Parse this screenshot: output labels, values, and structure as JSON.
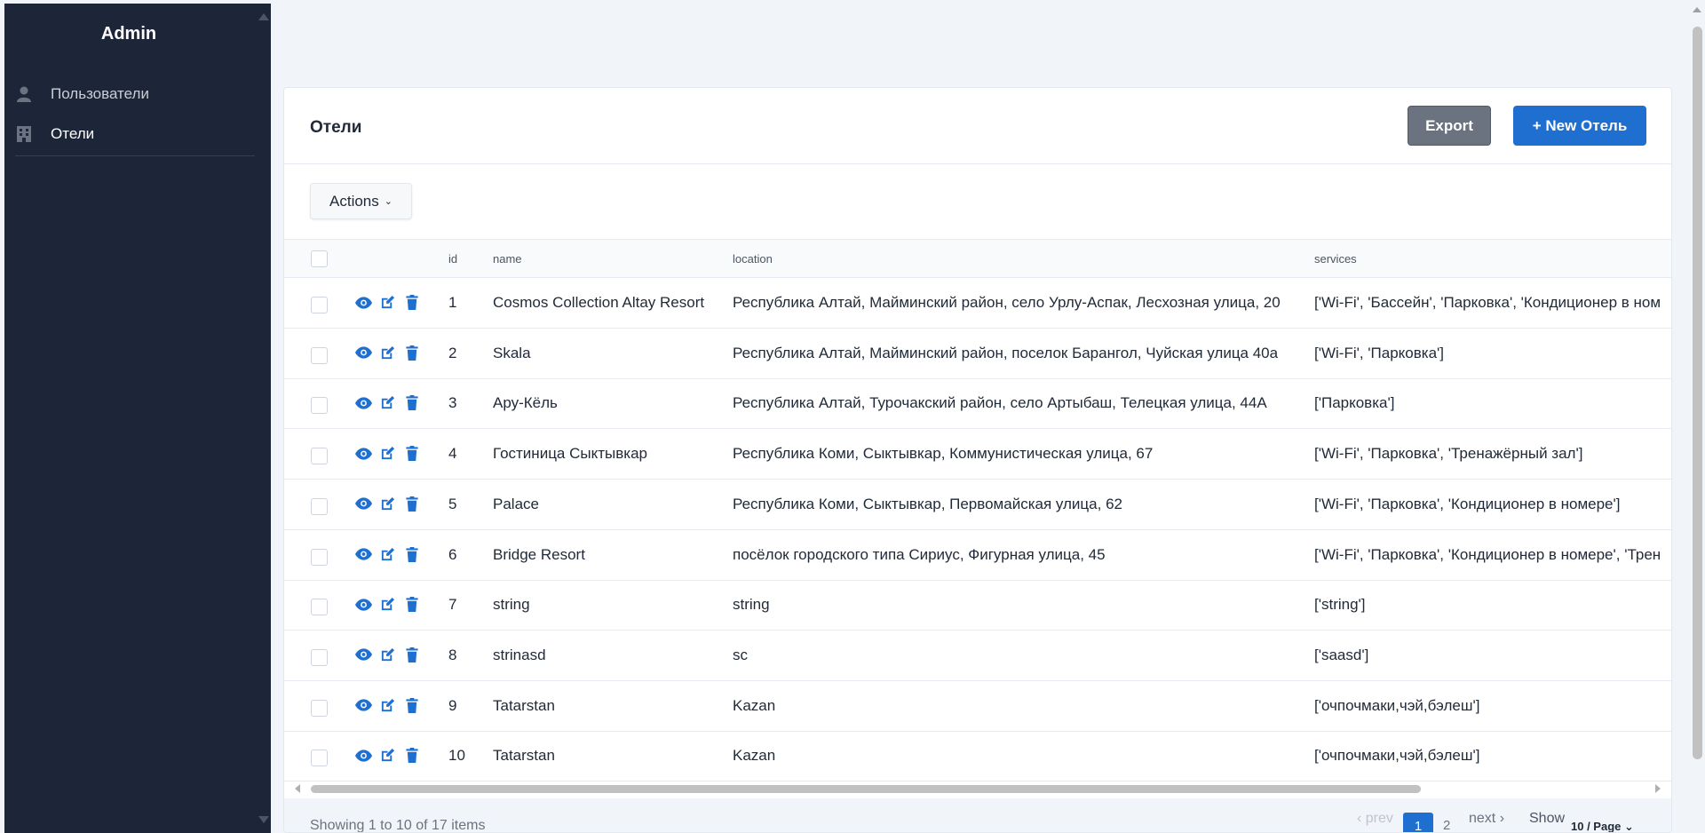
{
  "sidebar": {
    "brand": "Admin",
    "items": [
      {
        "label": "Пользователи",
        "icon": "user-icon"
      },
      {
        "label": "Отели",
        "icon": "building-icon"
      }
    ]
  },
  "page": {
    "title": "Отели",
    "export_label": "Export",
    "new_label": "+ New Отель",
    "actions_label": "Actions"
  },
  "table": {
    "columns": [
      "id",
      "name",
      "location",
      "services"
    ],
    "rows": [
      {
        "id": "1",
        "name": "Cosmos Collection Altay Resort",
        "location": "Республика Алтай, Майминский район, село Урлу-Аспак, Лесхозная улица, 20",
        "services": "['Wi-Fi', 'Бассейн', 'Парковка', 'Кондиционер в ном"
      },
      {
        "id": "2",
        "name": "Skala",
        "location": "Республика Алтай, Майминский район, поселок Барангол, Чуйская улица 40а",
        "services": "['Wi-Fi', 'Парковка']"
      },
      {
        "id": "3",
        "name": "Ару-Кёль",
        "location": "Республика Алтай, Турочакский район, село Артыбаш, Телецкая улица, 44А",
        "services": "['Парковка']"
      },
      {
        "id": "4",
        "name": "Гостиница Сыктывкар",
        "location": "Республика Коми, Сыктывкар, Коммунистическая улица, 67",
        "services": "['Wi-Fi', 'Парковка', 'Тренажёрный зал']"
      },
      {
        "id": "5",
        "name": "Palace",
        "location": "Республика Коми, Сыктывкар, Первомайская улица, 62",
        "services": "['Wi-Fi', 'Парковка', 'Кондиционер в номере']"
      },
      {
        "id": "6",
        "name": "Bridge Resort",
        "location": "посёлок городского типа Сириус, Фигурная улица, 45",
        "services": "['Wi-Fi', 'Парковка', 'Кондиционер в номере', 'Трен"
      },
      {
        "id": "7",
        "name": "string",
        "location": "string",
        "services": "['string']"
      },
      {
        "id": "8",
        "name": "strinasd",
        "location": "sc",
        "services": "['saasd']"
      },
      {
        "id": "9",
        "name": "Tatarstan",
        "location": "Kazan",
        "services": "['очпочмаки,чэй,бэлеш']"
      },
      {
        "id": "10",
        "name": "Tatarstan",
        "location": "Kazan",
        "services": "['очпочмаки,чэй,бэлеш']"
      }
    ]
  },
  "footer": {
    "showing": "Showing 1 to 10 of 17 items",
    "prev": "prev",
    "page1": "1",
    "page2": "2",
    "next": "next",
    "show": "Show",
    "page_size": "10 / Page"
  },
  "colors": {
    "sidebar_bg": "#1d2639",
    "primary": "#1f6fd1",
    "export_bg": "#6b7280"
  }
}
